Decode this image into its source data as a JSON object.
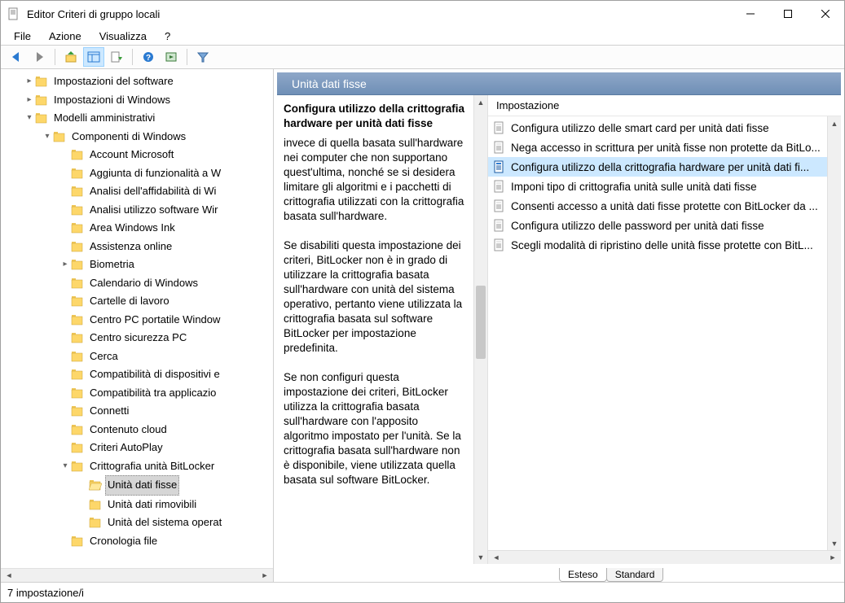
{
  "window": {
    "title": "Editor Criteri di gruppo locali"
  },
  "menu": {
    "file": "File",
    "action": "Azione",
    "view": "Visualizza",
    "help": "?"
  },
  "tree": {
    "items": [
      {
        "indent": 1,
        "caret": ">",
        "label": "Impostazioni del software"
      },
      {
        "indent": 1,
        "caret": ">",
        "label": "Impostazioni di Windows"
      },
      {
        "indent": 1,
        "caret": "v",
        "label": "Modelli amministrativi"
      },
      {
        "indent": 2,
        "caret": "v",
        "label": "Componenti di Windows"
      },
      {
        "indent": 3,
        "caret": "",
        "label": "Account Microsoft"
      },
      {
        "indent": 3,
        "caret": "",
        "label": "Aggiunta di funzionalità a W"
      },
      {
        "indent": 3,
        "caret": "",
        "label": "Analisi dell'affidabilità di Wi"
      },
      {
        "indent": 3,
        "caret": "",
        "label": "Analisi utilizzo software Wir"
      },
      {
        "indent": 3,
        "caret": "",
        "label": "Area Windows Ink"
      },
      {
        "indent": 3,
        "caret": "",
        "label": "Assistenza online"
      },
      {
        "indent": 3,
        "caret": ">",
        "label": "Biometria"
      },
      {
        "indent": 3,
        "caret": "",
        "label": "Calendario di Windows"
      },
      {
        "indent": 3,
        "caret": "",
        "label": "Cartelle di lavoro"
      },
      {
        "indent": 3,
        "caret": "",
        "label": "Centro PC portatile Window"
      },
      {
        "indent": 3,
        "caret": "",
        "label": "Centro sicurezza PC"
      },
      {
        "indent": 3,
        "caret": "",
        "label": "Cerca"
      },
      {
        "indent": 3,
        "caret": "",
        "label": "Compatibilità di dispositivi e"
      },
      {
        "indent": 3,
        "caret": "",
        "label": "Compatibilità tra applicazio"
      },
      {
        "indent": 3,
        "caret": "",
        "label": "Connetti"
      },
      {
        "indent": 3,
        "caret": "",
        "label": "Contenuto cloud"
      },
      {
        "indent": 3,
        "caret": "",
        "label": "Criteri AutoPlay"
      },
      {
        "indent": 3,
        "caret": "v",
        "label": "Crittografia unità BitLocker"
      },
      {
        "indent": 4,
        "caret": "",
        "label": "Unità dati fisse",
        "open": true,
        "selected": true
      },
      {
        "indent": 4,
        "caret": "",
        "label": "Unità dati rimovibili"
      },
      {
        "indent": 4,
        "caret": "",
        "label": "Unità del sistema operat"
      },
      {
        "indent": 3,
        "caret": "",
        "label": "Cronologia file"
      }
    ]
  },
  "right": {
    "folder_title": "Unità dati fisse",
    "desc_title": "Configura utilizzo della crittografia hardware per unità dati fisse",
    "desc_body": "invece di quella basata sull'hardware nei computer che non supportano quest'ultima, nonché se si desidera limitare gli algoritmi e i pacchetti di crittografia utilizzati con la crittografia basata sull'hardware.\n\nSe disabiliti questa impostazione dei criteri, BitLocker non è in grado di utilizzare la crittografia basata sull'hardware con unità del sistema operativo, pertanto viene utilizzata la crittografia basata sul software BitLocker per impostazione predefinita.\n\nSe non configuri questa impostazione dei criteri, BitLocker utilizza la crittografia basata sull'hardware con l'apposito algoritmo impostato per l'unità. Se la crittografia basata sull'hardware non è disponibile, viene utilizzata quella basata sul software BitLocker.",
    "list_header": "Impostazione",
    "items": [
      {
        "label": "Configura utilizzo delle smart card per unità dati fisse",
        "selected": false
      },
      {
        "label": "Nega accesso in scrittura per unità fisse non protette da BitLo...",
        "selected": false
      },
      {
        "label": "Configura utilizzo della crittografia hardware per unità dati fi...",
        "selected": true
      },
      {
        "label": "Imponi tipo di crittografia unità sulle unità dati fisse",
        "selected": false
      },
      {
        "label": "Consenti accesso a unità dati fisse protette con BitLocker da ...",
        "selected": false
      },
      {
        "label": "Configura utilizzo delle password per unità dati fisse",
        "selected": false
      },
      {
        "label": "Scegli modalità di ripristino delle unità fisse protette con BitL...",
        "selected": false
      }
    ],
    "tabs": {
      "extended": "Esteso",
      "standard": "Standard"
    }
  },
  "status": {
    "count": "7 impostazione/i"
  }
}
